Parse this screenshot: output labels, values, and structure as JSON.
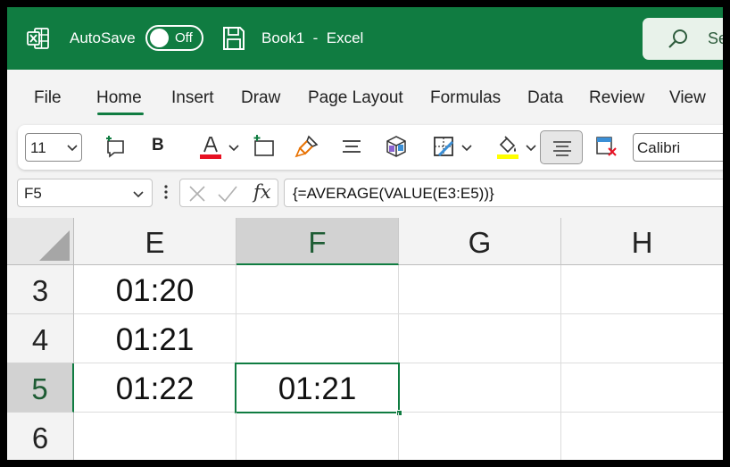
{
  "window": {
    "autosave_label": "AutoSave",
    "autosave_state": "Off",
    "doc_title": "Book1  -  Excel",
    "search_text": "Se"
  },
  "menu": {
    "tabs": [
      "File",
      "Home",
      "Insert",
      "Draw",
      "Page Layout",
      "Formulas",
      "Data",
      "Review",
      "View"
    ],
    "active_tab": "Home"
  },
  "ribbon": {
    "font_size": "11",
    "bold_label": "B",
    "font_name": "Calibri",
    "font_color": "#e81123",
    "highlight_color": "#ffff00",
    "icons": [
      "new-comment-icon",
      "bold-icon",
      "font-color-icon",
      "insert-icon",
      "format-painter-icon",
      "align-icon",
      "cube-icon",
      "borders-icon",
      "fill-color-icon",
      "center-align-icon",
      "clear-icon"
    ]
  },
  "formula_bar": {
    "name_box": "F5",
    "fx_label": "fx",
    "formula": "{=AVERAGE(VALUE(E3:E5))}"
  },
  "sheet": {
    "columns": [
      "E",
      "F",
      "G",
      "H"
    ],
    "selected_column": "F",
    "rows": [
      {
        "num": "3",
        "E": "01:20",
        "F": ""
      },
      {
        "num": "4",
        "E": "01:21",
        "F": ""
      },
      {
        "num": "5",
        "E": "01:22",
        "F": "01:21"
      },
      {
        "num": "6",
        "E": "",
        "F": ""
      }
    ],
    "selected_row": "5",
    "accent": "#107c41"
  }
}
